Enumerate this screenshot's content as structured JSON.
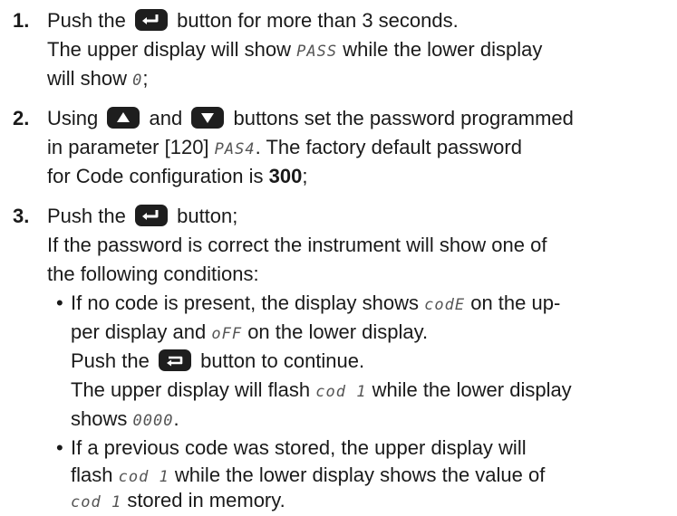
{
  "step1": {
    "num": "1.",
    "l1a": "Push the",
    "l1b": "button for more than 3 seconds.",
    "l2a": "The upper display will show",
    "l2seg": "PASS",
    "l2b": "while the lower display",
    "l3a": "will show",
    "l3seg": "0",
    "l3b": ";"
  },
  "step2": {
    "num": "2.",
    "l1a": "Using",
    "l1b": "and",
    "l1c": "buttons set the password programmed",
    "l2a": "in parameter [120]",
    "l2seg": "PAS4",
    "l2b": ". The factory default password",
    "l3a": "for Code configuration is",
    "l3bold": "300",
    "l3b": ";"
  },
  "step3": {
    "num": "3.",
    "l1a": "Push the",
    "l1b": "button;",
    "l2": "If the password is correct the instrument will show one of",
    "l3": "the following conditions:",
    "b1": {
      "bullet": "•",
      "l1a": "If no code is present, the display shows",
      "l1seg": "codE",
      "l1b": "on the up-",
      "l2a": "per display and",
      "l2seg": "oFF",
      "l2b": "on the lower display.",
      "l3a": "Push the",
      "l3b": "button to continue.",
      "l4a": "The upper display will flash",
      "l4seg": "cod 1",
      "l4b": "while the lower display",
      "l5a": "shows",
      "l5seg": "0000",
      "l5b": "."
    },
    "b2": {
      "bullet": "•",
      "l1": "If a previous code was stored, the upper display will",
      "l2a": "flash",
      "l2seg": "cod 1",
      "l2b": "while the lower display shows the value of",
      "l3seg": "cod 1",
      "l3b": "stored in memory."
    }
  },
  "icons": {
    "enter": "enter-key-icon",
    "up": "up-arrow-key-icon",
    "down": "down-arrow-key-icon",
    "loop": "loop-key-icon"
  },
  "colors": {
    "text": "#1a1a1a",
    "button": "#1e1e1e",
    "segment_text": "#555555"
  }
}
